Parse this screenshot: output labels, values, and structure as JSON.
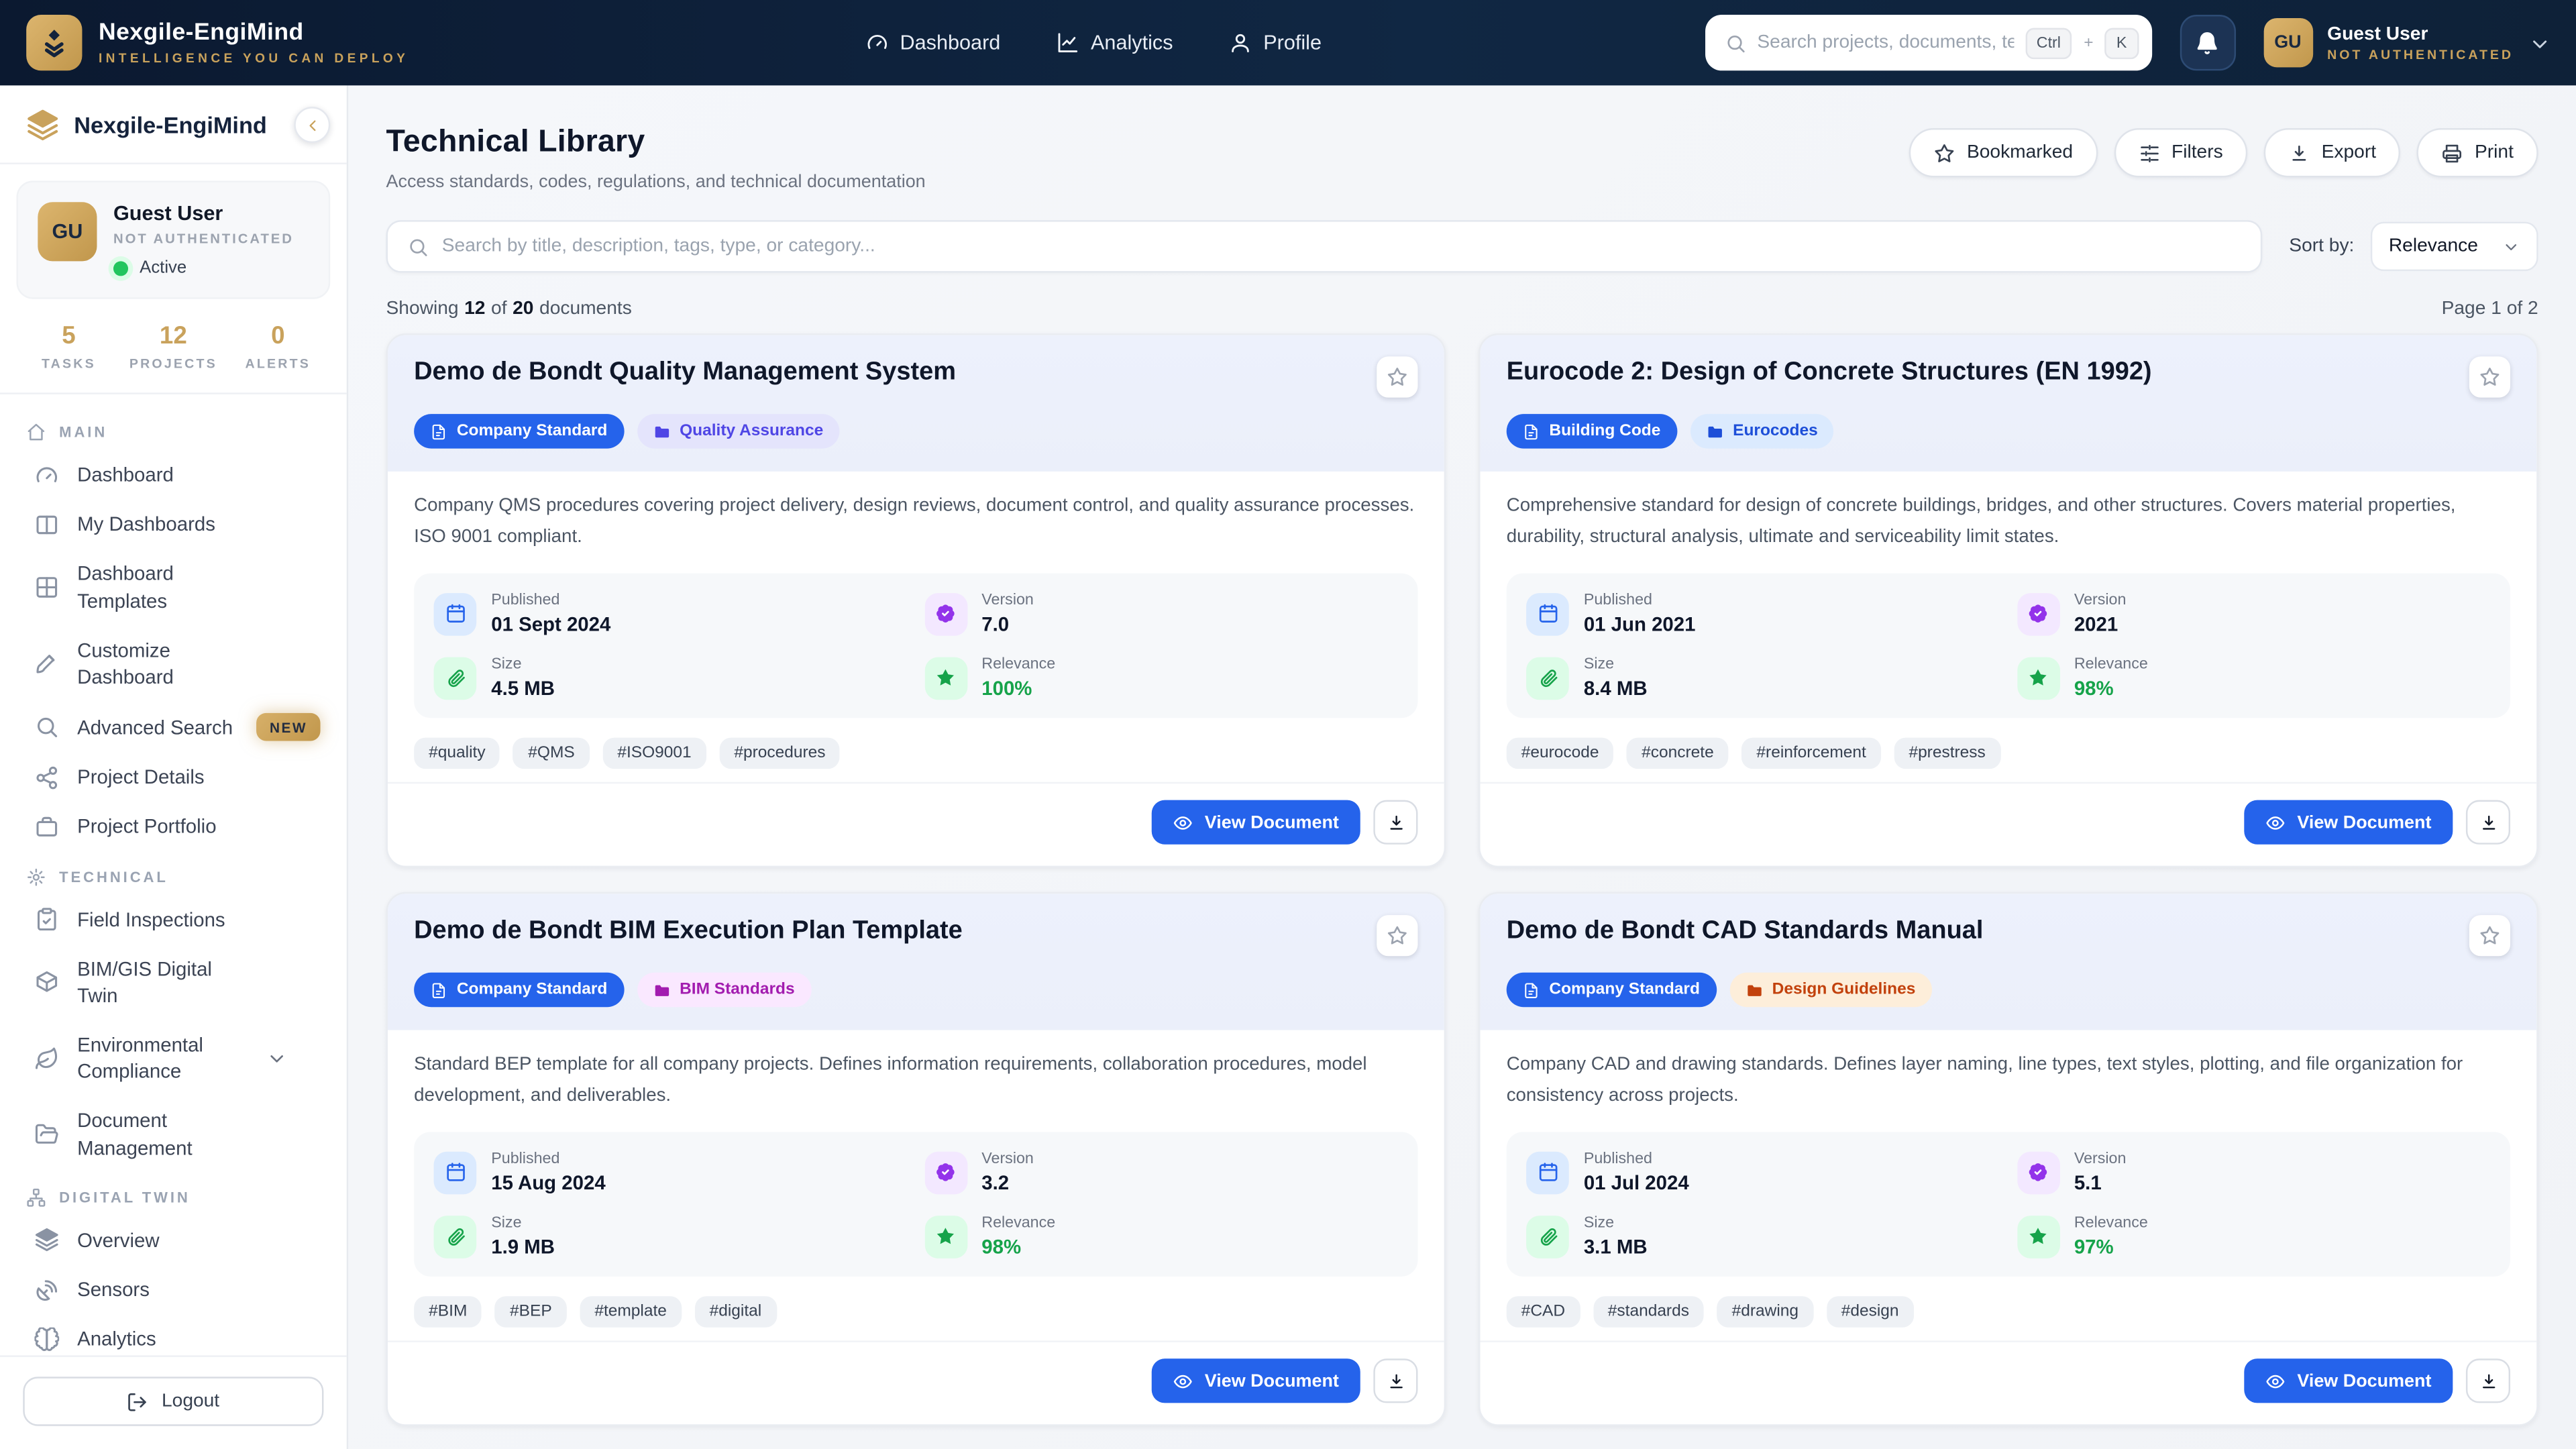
{
  "colors": {
    "navy": "#0c1a2c",
    "gold": "#c9a25c",
    "accent_blue": "#2563eb",
    "green": "#16a34a",
    "purple": "#9333ea",
    "card_header_tint": "#edf1fc"
  },
  "navbar": {
    "brand": "Nexgile-EngiMind",
    "tagline": "INTELLIGENCE YOU CAN DEPLOY",
    "items": [
      {
        "icon": "gauge",
        "label": "Dashboard"
      },
      {
        "icon": "chart",
        "label": "Analytics"
      },
      {
        "icon": "user",
        "label": "Profile"
      }
    ],
    "search": {
      "placeholder": "Search projects, documents, te...",
      "keys": [
        "Ctrl",
        "K"
      ],
      "plus": "+"
    },
    "user": {
      "initials": "GU",
      "name": "Guest User",
      "status": "NOT AUTHENTICATED"
    }
  },
  "sidebar": {
    "brand": "Nexgile-EngiMind",
    "user": {
      "initials": "GU",
      "name": "Guest User",
      "auth": "NOT AUTHENTICATED",
      "status": "Active"
    },
    "stats": [
      {
        "value": "5",
        "label": "TASKS"
      },
      {
        "value": "12",
        "label": "PROJECTS"
      },
      {
        "value": "0",
        "label": "ALERTS"
      }
    ],
    "sections": [
      {
        "label": "MAIN",
        "icon": "home",
        "items": [
          {
            "icon": "gauge",
            "label": "Dashboard"
          },
          {
            "icon": "columns",
            "label": "My Dashboards"
          },
          {
            "icon": "grid",
            "label": "Dashboard Templates"
          },
          {
            "icon": "brush",
            "label": "Customize Dashboard"
          },
          {
            "icon": "search",
            "label": "Advanced Search",
            "badge": "NEW"
          },
          {
            "icon": "network",
            "label": "Project Details"
          },
          {
            "icon": "briefcase",
            "label": "Project Portfolio"
          }
        ]
      },
      {
        "label": "TECHNICAL",
        "icon": "gears",
        "items": [
          {
            "icon": "clipboard",
            "label": "Field Inspections"
          },
          {
            "icon": "cube",
            "label": "BIM/GIS Digital Twin"
          },
          {
            "icon": "leaf",
            "label": "Environmental Compliance",
            "chevron": true
          },
          {
            "icon": "folderopen",
            "label": "Document Management"
          }
        ]
      },
      {
        "label": "DIGITAL TWIN",
        "icon": "sitemap",
        "items": [
          {
            "icon": "layers",
            "label": "Overview"
          },
          {
            "icon": "satellite",
            "label": "Sensors"
          },
          {
            "icon": "brain",
            "label": "Analytics"
          }
        ]
      }
    ],
    "logout_label": "Logout"
  },
  "page": {
    "title": "Technical Library",
    "subtitle": "Access standards, codes, regulations, and technical documentation",
    "actions": [
      {
        "icon": "star",
        "label": "Bookmarked"
      },
      {
        "icon": "sliders",
        "label": "Filters"
      },
      {
        "icon": "download",
        "label": "Export"
      },
      {
        "icon": "printer",
        "label": "Print"
      }
    ],
    "search_placeholder": "Search by title, description, tags, type, or category...",
    "sort_label": "Sort by:",
    "sort_value": "Relevance",
    "results": {
      "prefix": "Showing",
      "shown": "12",
      "mid": "of",
      "total": "20",
      "suffix": "documents"
    },
    "page_info": "Page 1 of 2"
  },
  "card_ui": {
    "meta_labels": {
      "published": "Published",
      "version": "Version",
      "size": "Size",
      "relevance": "Relevance"
    },
    "view_button": "View Document"
  },
  "cards": [
    {
      "title": "Demo de Bondt Quality Management System",
      "type_badge": "Company Standard",
      "category_badge": {
        "label": "Quality Assurance",
        "bg": "#e4e4fc",
        "color": "#4f46e5"
      },
      "description": "Company QMS procedures covering project delivery, design reviews, document control, and quality assurance processes. ISO 9001 compliant.",
      "published": "01 Sept 2024",
      "version": "7.0",
      "size": "4.5 MB",
      "relevance": "100%",
      "tags": [
        "#quality",
        "#QMS",
        "#ISO9001",
        "#procedures"
      ]
    },
    {
      "title": "Eurocode 2: Design of Concrete Structures (EN 1992)",
      "type_badge": "Building Code",
      "category_badge": {
        "label": "Eurocodes",
        "bg": "#dbeafe",
        "color": "#1d4ed8"
      },
      "description": "Comprehensive standard for design of concrete buildings, bridges, and other structures. Covers material properties, durability, structural analysis, ultimate and serviceability limit states.",
      "published": "01 Jun 2021",
      "version": "2021",
      "size": "8.4 MB",
      "relevance": "98%",
      "tags": [
        "#eurocode",
        "#concrete",
        "#reinforcement",
        "#prestress"
      ]
    },
    {
      "title": "Demo de Bondt BIM Execution Plan Template",
      "type_badge": "Company Standard",
      "category_badge": {
        "label": "BIM Standards",
        "bg": "#fae8ff",
        "color": "#a21caf"
      },
      "description": "Standard BEP template for all company projects. Defines information requirements, collaboration procedures, model development, and deliverables.",
      "published": "15 Aug 2024",
      "version": "3.2",
      "size": "1.9 MB",
      "relevance": "98%",
      "tags": [
        "#BIM",
        "#BEP",
        "#template",
        "#digital"
      ]
    },
    {
      "title": "Demo de Bondt CAD Standards Manual",
      "type_badge": "Company Standard",
      "category_badge": {
        "label": "Design Guidelines",
        "bg": "#fdeeda",
        "color": "#c2410c"
      },
      "description": "Company CAD and drawing standards. Defines layer naming, line types, text styles, plotting, and file organization for consistency across projects.",
      "published": "01 Jul 2024",
      "version": "5.1",
      "size": "3.1 MB",
      "relevance": "97%",
      "tags": [
        "#CAD",
        "#standards",
        "#drawing",
        "#design"
      ]
    }
  ]
}
